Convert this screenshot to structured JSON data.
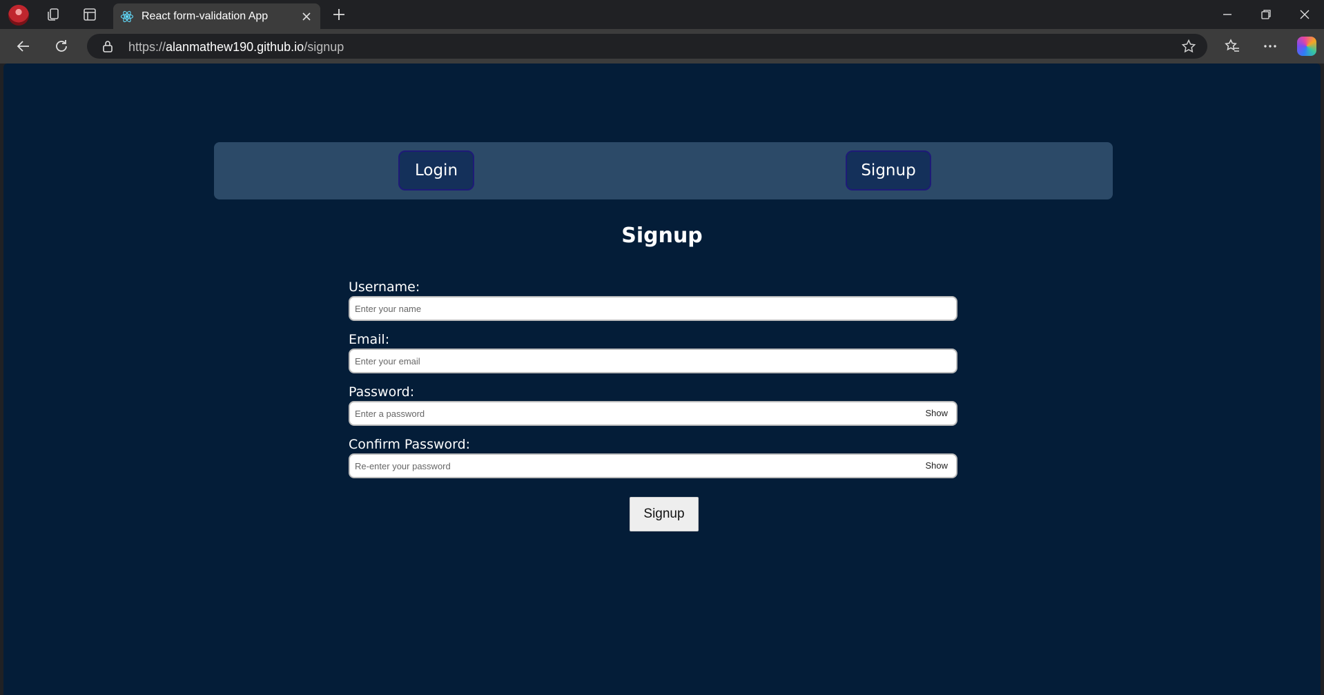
{
  "browser": {
    "tab": {
      "title": "React form-validation App",
      "favicon": "react-icon"
    },
    "address": {
      "scheme": "https://",
      "host": "alanmathew190.github.io",
      "path": "/signup"
    },
    "icons": [
      "workspaces-icon",
      "vertical-tabs-icon",
      "close-icon",
      "plus-icon",
      "minimize-icon",
      "restore-icon",
      "window-close-icon",
      "back-icon",
      "refresh-icon",
      "lock-icon",
      "star-icon",
      "favorites-icon",
      "more-icon",
      "copilot-icon"
    ]
  },
  "page": {
    "nav": {
      "login_label": "Login",
      "signup_label": "Signup"
    },
    "heading": "Signup",
    "fields": [
      {
        "label": "Username:",
        "placeholder": "Enter your name",
        "value": ""
      },
      {
        "label": "Email:",
        "placeholder": "Enter your email",
        "value": ""
      },
      {
        "label": "Password:",
        "placeholder": "Enter a password",
        "value": "",
        "toggle": "Show"
      },
      {
        "label": "Confirm Password:",
        "placeholder": "Re-enter your password",
        "value": "",
        "toggle": "Show"
      }
    ],
    "submit_label": "Signup"
  },
  "colors": {
    "page_background": "#041d38",
    "nav_background": "#2c4a68",
    "nav_button_border": "#1e1a78"
  }
}
